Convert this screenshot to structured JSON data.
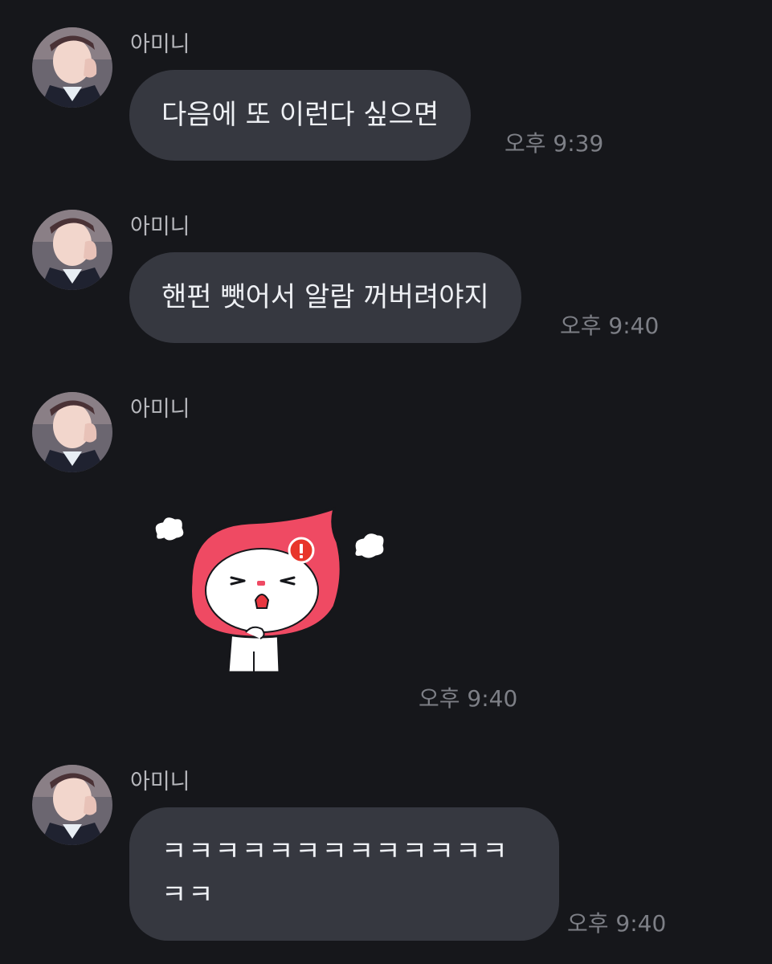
{
  "messages": [
    {
      "sender": "아미니",
      "text": "다음에 또 이런다 싶으면",
      "time": "오후 9:39"
    },
    {
      "sender": "아미니",
      "text": "핸펀 뺏어서 알람 꺼버려야지",
      "time": "오후 9:40"
    },
    {
      "sender": "아미니",
      "sticker": "angry-red-hood-character-sticker",
      "time": "오후 9:40"
    },
    {
      "sender": "아미니",
      "text_line1": "ㅋㅋㅋㅋㅋㅋㅋㅋㅋㅋㅋㅋㅋ",
      "text_line2": "ㅋㅋ",
      "time": "오후 9:40"
    }
  ],
  "colors": {
    "background": "#16171b",
    "bubble": "#363840",
    "sticker_hood": "#ef4a63",
    "badge": "#e8362a"
  }
}
